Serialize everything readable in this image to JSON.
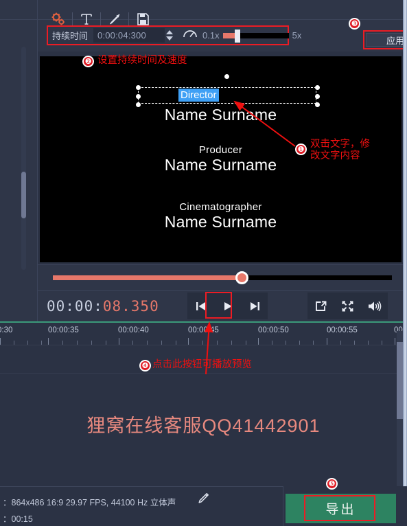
{
  "toolbar": {
    "icons": [
      {
        "name": "settings-gears-icon",
        "label": "设置"
      },
      {
        "name": "text-tool-icon",
        "label": "T"
      },
      {
        "name": "color-picker-pen-icon",
        "label": "画笔"
      },
      {
        "name": "save-disk-icon",
        "label": "保存"
      }
    ],
    "duration_label": "持续时间",
    "duration_value": "0:00:04:300",
    "speed_min": "0.1x",
    "speed_max": "5x",
    "speed_value": 0.18,
    "apply_label": "应用"
  },
  "preview": {
    "selected_text": "Director",
    "credits": [
      {
        "role": "Director",
        "name": "Name Surname"
      },
      {
        "role": "Producer",
        "name": "Name Surname"
      },
      {
        "role": "Cinematographer",
        "name": "Name Surname"
      }
    ]
  },
  "player": {
    "timecode_prefix": "00:00:",
    "timecode_suffix": "08.350",
    "seek_progress": 55.6,
    "buttons": [
      {
        "name": "previous-frame-button",
        "glyph": "prev"
      },
      {
        "name": "play-button",
        "glyph": "play"
      },
      {
        "name": "next-frame-button",
        "glyph": "next"
      }
    ],
    "right_buttons": [
      {
        "name": "snapshot-button",
        "glyph": "snapshot"
      },
      {
        "name": "fullscreen-button",
        "glyph": "fullscreen"
      },
      {
        "name": "volume-button",
        "glyph": "volume"
      }
    ]
  },
  "timeline": {
    "ruler_labels": [
      "0:30",
      "00:00:35",
      "00:00:40",
      "00:00:45",
      "00:00:50",
      "00:00:55",
      "00"
    ],
    "watermark": "狸窝在线客服QQ41442901"
  },
  "statusbar": {
    "line1": "：864x486 16:9 29.97 FPS, 44100 Hz 立体声",
    "line2": "：00:15",
    "edit-icon": "pencil-icon",
    "export_label": "导出"
  },
  "annotations": [
    {
      "id": 1,
      "num": "❶",
      "text": "双击文字，修\n改文字内容"
    },
    {
      "id": 2,
      "num": "❷",
      "text": "设置持续时间及速度"
    },
    {
      "id": 3,
      "num": "❸",
      "text": ""
    },
    {
      "id": 4,
      "num": "❹",
      "text": "点击此按钮可播放预览"
    },
    {
      "id": 5,
      "num": "❺",
      "text": ""
    }
  ],
  "colors": {
    "accent_red": "#ec1c24",
    "accent_salmon": "#e7786a",
    "export_green": "#2d8361",
    "panel_bg": "#2f3648",
    "app_bg": "#2b3244",
    "selection_blue": "#3fa0f5"
  }
}
